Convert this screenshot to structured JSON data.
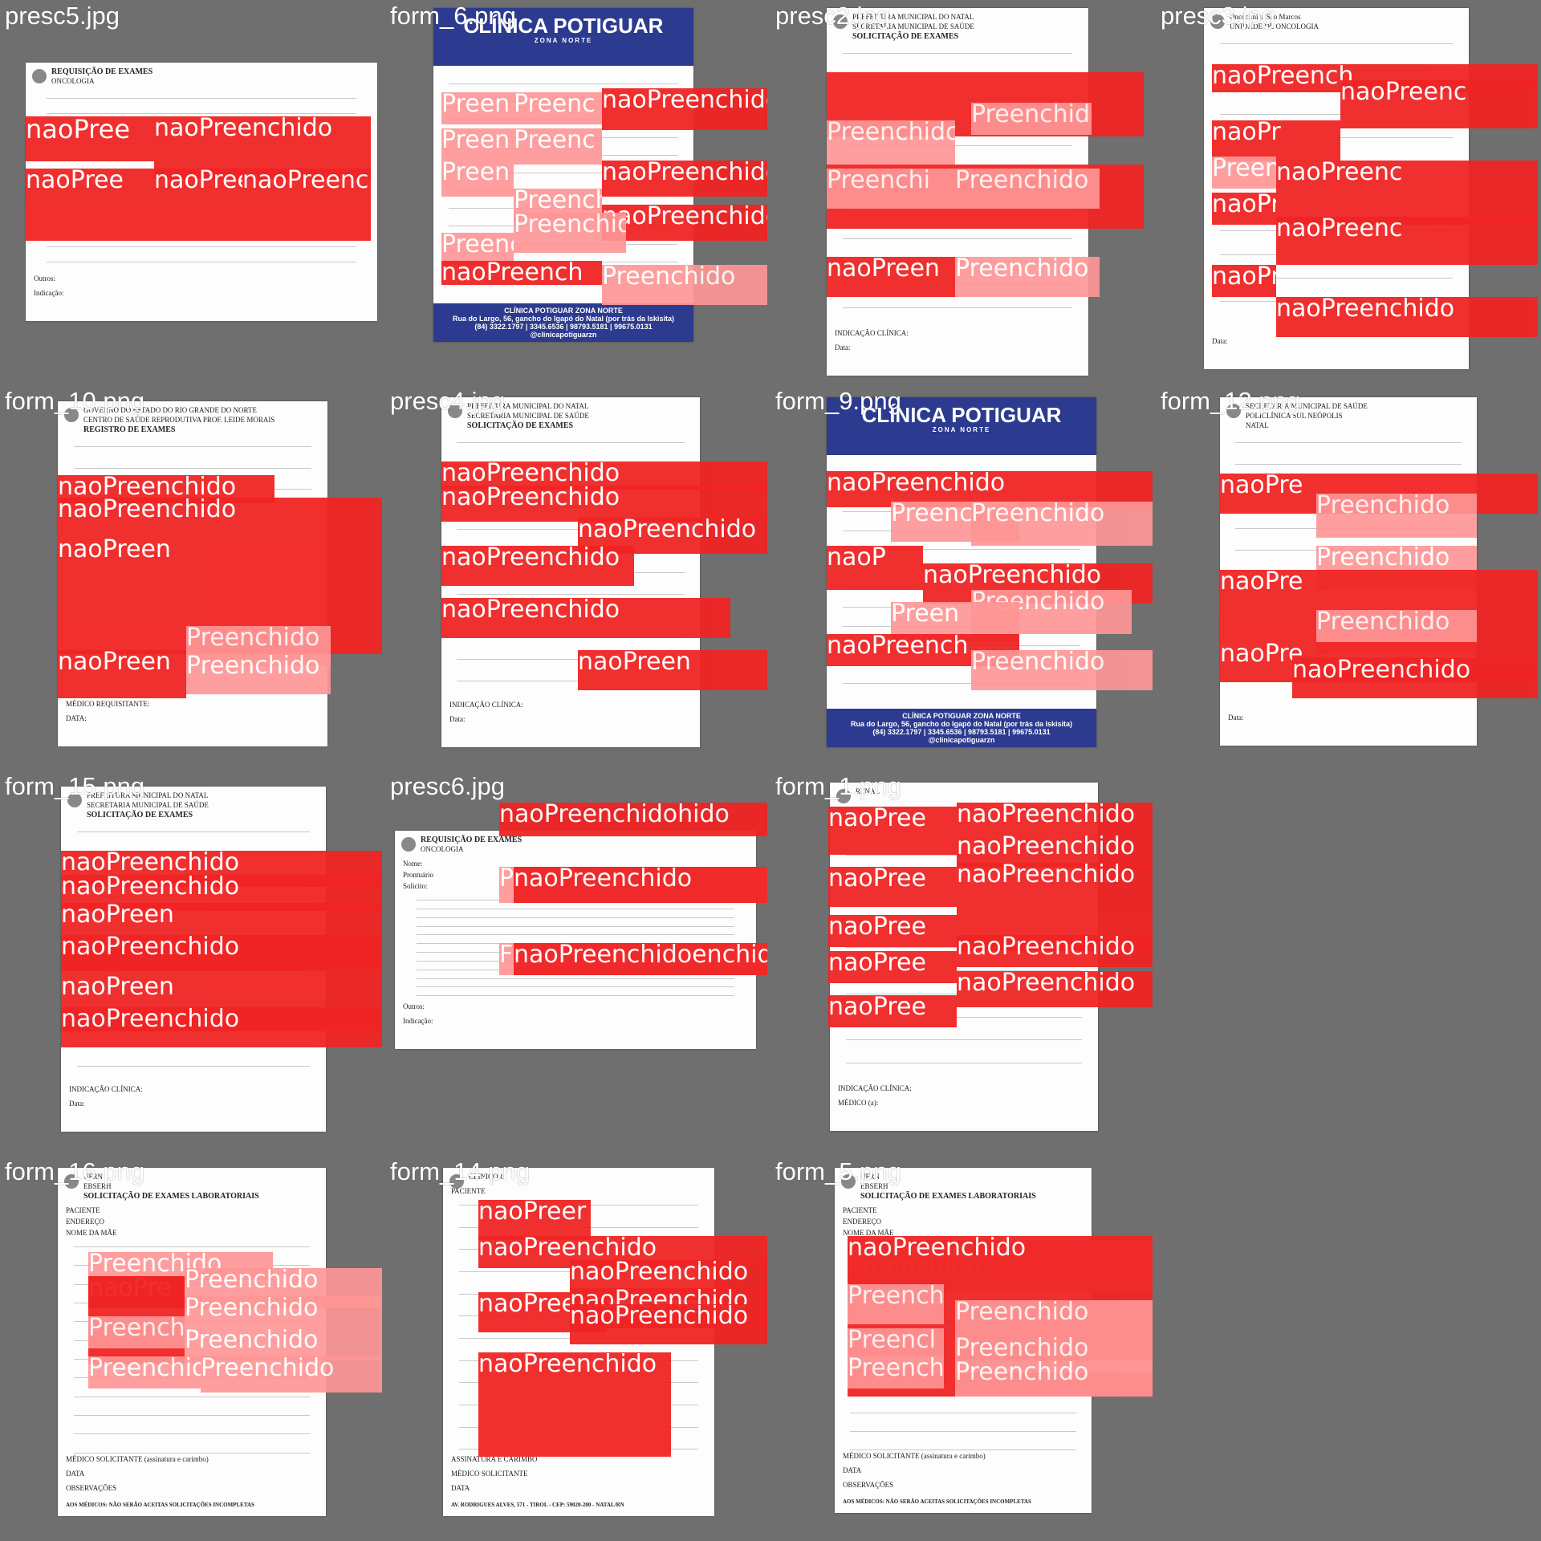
{
  "colors": {
    "background": "#6f6f6f",
    "nao_preenchido": "#f02424",
    "preenchido": "#ff9696",
    "clinic_blue": "#2c3b8f"
  },
  "tiles": [
    {
      "label": "presc5.jpg",
      "doc": {
        "title": "REQUISIÇÃO DE EXAMES",
        "subtitle": "ONCOLOGIA",
        "footer_lines": [
          "Outros:",
          "Indicação:"
        ]
      },
      "boxes": [
        {
          "cls": "naoPreenchido",
          "text": "naoPree"
        },
        {
          "cls": "naoPreenchido",
          "text": "naoPreenchido"
        },
        {
          "cls": "naoPreenchido",
          "text": "naoPree"
        },
        {
          "cls": "naoPreenchido",
          "text": "naoPree"
        },
        {
          "cls": "naoPreenchido",
          "text": "naoPreenchido"
        }
      ]
    },
    {
      "label": "form_6.png",
      "doc": {
        "banner_title": "CLÍNICA POTIGUAR",
        "banner_sub": "ZONA NORTE",
        "footer_title": "CLÍNICA POTIGUAR ZONA NORTE",
        "footer_line1": "Rua do Largo, 56, gancho do Igapó do Natal (por trás da Iskisita)",
        "footer_line2": "(84) 3322.1797 | 3345.6536 | 98793.5181 | 99675.0131",
        "footer_line3": "@clinicapotiguarzn"
      },
      "boxes": [
        {
          "cls": "Preenchido",
          "text": "Preen"
        },
        {
          "cls": "Preenchido",
          "text": "Preenc"
        },
        {
          "cls": "naoPreenchido",
          "text": "naoPreenchido"
        },
        {
          "cls": "Preenchido",
          "text": "Preen"
        },
        {
          "cls": "Preenchido",
          "text": "Preenc"
        },
        {
          "cls": "naoPreenchido",
          "text": "naoPreenchido"
        },
        {
          "cls": "Preenchido",
          "text": "Preen"
        },
        {
          "cls": "Preenchido",
          "text": "Preenchido"
        },
        {
          "cls": "naoPreenchido",
          "text": "naoPreenchido"
        },
        {
          "cls": "Preenchido",
          "text": "Preenc"
        },
        {
          "cls": "Preenchido",
          "text": "Preenchido"
        },
        {
          "cls": "naoPreenchido",
          "text": "naoPreench"
        },
        {
          "cls": "Preenchido",
          "text": "Preenchido"
        }
      ]
    },
    {
      "label": "presc2.jpg",
      "doc": {
        "header1": "PREFEITURA MUNICIPAL DO NATAL",
        "header2": "SECRETARIA MUNICIPAL DE SAÚDE",
        "title": "SOLICITAÇÃO DE EXAMES",
        "footer_lines": [
          "INDICAÇÃO CLÍNICA:",
          "Data:"
        ]
      },
      "boxes": [
        {
          "cls": "naoPreenchido",
          "text": ""
        },
        {
          "cls": "Preenchido",
          "text": "Preenchido"
        },
        {
          "cls": "Preenchido",
          "text": "Preenchido"
        },
        {
          "cls": "naoPreenchido",
          "text": ""
        },
        {
          "cls": "Preenchido",
          "text": "Preenchi"
        },
        {
          "cls": "Preenchido",
          "text": "Preenchido"
        },
        {
          "cls": "naoPreenchido",
          "text": "naoPreen"
        },
        {
          "cls": "Preenchido",
          "text": "Preenchido"
        }
      ]
    },
    {
      "label": "presc3.jpg",
      "doc": {
        "header1": "Oncoclínica São Marcos",
        "header2": "UNIDADE DE ONCOLOGIA",
        "footer_lines": [
          "Data:"
        ]
      },
      "boxes": [
        {
          "cls": "naoPreenchido",
          "text": "naoPreench"
        },
        {
          "cls": "naoPreenchido",
          "text": "naoPreenc"
        },
        {
          "cls": "naoPreenchido",
          "text": "naoPr"
        },
        {
          "cls": "Preenchido",
          "text": "Preen"
        },
        {
          "cls": "naoPreenchido",
          "text": "naoPreenc"
        },
        {
          "cls": "naoPreenchido",
          "text": "naoPr"
        },
        {
          "cls": "naoPreenchido",
          "text": "naoPreenc"
        },
        {
          "cls": "naoPreenchido",
          "text": "naoPr"
        },
        {
          "cls": "naoPreenchido",
          "text": "naoPreenchido"
        }
      ]
    },
    {
      "label": "form_10.png",
      "doc": {
        "header1": "GOVERNO DO ESTADO DO RIO GRANDE DO NORTE",
        "header2": "CENTRO DE SAÚDE REPRODUTIVA PROF. LEIDE MORAIS",
        "title": "REGISTRO DE EXAMES",
        "footer_lines": [
          "MÉDICO REQUISITANTE:",
          "DATA:"
        ]
      },
      "boxes": [
        {
          "cls": "naoPreenchido",
          "text": "naoPreenchido"
        },
        {
          "cls": "naoPreenchido",
          "text": "naoPreenchido"
        },
        {
          "cls": "naoPreenchido",
          "text": "naoPreen"
        },
        {
          "cls": "Preenchido",
          "text": "Preenchido"
        },
        {
          "cls": "naoPreenchido",
          "text": "naoPreen"
        },
        {
          "cls": "Preenchido",
          "text": "Preenchido"
        }
      ]
    },
    {
      "label": "presc4.jpg",
      "doc": {
        "header1": "PREFEITURA MUNICIPAL DO NATAL",
        "header2": "SECRETARIA MUNICIPAL DE SAÚDE",
        "title": "SOLICITAÇÃO DE EXAMES",
        "footer_lines": [
          "INDICAÇÃO CLÍNICA:",
          "Data:"
        ]
      },
      "boxes": [
        {
          "cls": "naoPreenchido",
          "text": "naoPreenchido"
        },
        {
          "cls": "naoPreenchido",
          "text": "naoPreenchido"
        },
        {
          "cls": "naoPreenchido",
          "text": "naoPreenchido"
        },
        {
          "cls": "naoPreenchido",
          "text": "naoPreenchido"
        },
        {
          "cls": "naoPreenchido",
          "text": "naoPreenchido"
        },
        {
          "cls": "naoPreenchido",
          "text": "naoPreen"
        }
      ]
    },
    {
      "label": "form_9.png",
      "doc": {
        "banner_title": "CLÍNICA POTIGUAR",
        "banner_sub": "ZONA NORTE",
        "footer_title": "CLÍNICA POTIGUAR ZONA NORTE",
        "footer_line1": "Rua do Largo, 56, gancho do Igapó do Natal (por trás da Iskisita)",
        "footer_line2": "(84) 3322.1797 | 3345.6536 | 98793.5181 | 99675.0131",
        "footer_line3": "@clinicapotiguarzn"
      },
      "boxes": [
        {
          "cls": "naoPreenchido",
          "text": "naoPreenchido"
        },
        {
          "cls": "Preenchido",
          "text": "Preenc"
        },
        {
          "cls": "Preenchido",
          "text": "Preenchido"
        },
        {
          "cls": "naoPreenchido",
          "text": "naoP"
        },
        {
          "cls": "naoPreenchido",
          "text": "naoPreenchido"
        },
        {
          "cls": "Preenchido",
          "text": "Preenchido"
        },
        {
          "cls": "Preenchido",
          "text": "Preen"
        },
        {
          "cls": "naoPreenchido",
          "text": "naoPreench"
        },
        {
          "cls": "Preenchido",
          "text": "Preenchido"
        }
      ]
    },
    {
      "label": "form_12.png",
      "doc": {
        "header1": "SECRETARIA MUNICIPAL DE SAÚDE",
        "header2": "POLICLÍNICA SUL NEÓPOLIS",
        "header3": "NATAL",
        "footer_lines": [
          "Data:"
        ]
      },
      "boxes": [
        {
          "cls": "naoPreenchido",
          "text": "naoPre"
        },
        {
          "cls": "Preenchido",
          "text": "Preenchido"
        },
        {
          "cls": "Preenchido",
          "text": "Preenchido"
        },
        {
          "cls": "naoPreenchido",
          "text": "naoPre"
        },
        {
          "cls": "Preenchido",
          "text": "Preenchido"
        },
        {
          "cls": "naoPreenchido",
          "text": "naoPre"
        },
        {
          "cls": "naoPreenchido",
          "text": "naoPreenchido"
        }
      ]
    },
    {
      "label": "form_15.png",
      "doc": {
        "header1": "PREFEITURA MUNICIPAL DO NATAL",
        "header2": "SECRETARIA MUNICIPAL DE SAÚDE",
        "title": "SOLICITAÇÃO DE EXAMES",
        "footer_lines": [
          "INDICAÇÃO CLÍNICA:",
          "Data:"
        ]
      },
      "boxes": [
        {
          "cls": "naoPreenchido",
          "text": "naoPreenchido"
        },
        {
          "cls": "naoPreenchido",
          "text": "naoPreenchido"
        },
        {
          "cls": "naoPreenchido",
          "text": "naoPreen"
        },
        {
          "cls": "naoPreenchido",
          "text": "naoPreenchido"
        },
        {
          "cls": "naoPreenchido",
          "text": "naoPreen"
        },
        {
          "cls": "naoPreenchido",
          "text": "naoPreenchido"
        }
      ]
    },
    {
      "label": "presc6.jpg",
      "doc": {
        "title": "REQUISIÇÃO DE EXAMES",
        "subtitle": "ONCOLOGIA",
        "field1": "Nome:",
        "field2": "Prontuário",
        "field3": "Solicito:",
        "footer_lines": [
          "Outros:",
          "Indicação:"
        ]
      },
      "boxes": [
        {
          "cls": "naoPreenchido",
          "text": "naoPreenchidohido"
        },
        {
          "cls": "Preenchido",
          "text": "P"
        },
        {
          "cls": "naoPreenchido",
          "text": "naoPreenchido"
        },
        {
          "cls": "Preenchido",
          "text": "F"
        },
        {
          "cls": "naoPreenchido",
          "text": "naoPreenchidoenchido"
        }
      ]
    },
    {
      "label": "form_1.png",
      "doc": {
        "header1": "RENAL",
        "footer_lines": [
          "INDICAÇÃO CLÍNICA:",
          "MÉDICO (a):"
        ]
      },
      "boxes": [
        {
          "cls": "naoPreenchido",
          "text": "naoPree"
        },
        {
          "cls": "naoPreenchido",
          "text": "naoPreenchido"
        },
        {
          "cls": "naoPreenchido",
          "text": "naoPreenchido"
        },
        {
          "cls": "naoPreenchido",
          "text": "naoPree"
        },
        {
          "cls": "naoPreenchido",
          "text": "naoPreenchido"
        },
        {
          "cls": "naoPreenchido",
          "text": "naoPree"
        },
        {
          "cls": "naoPreenchido",
          "text": "naoPreenchido"
        },
        {
          "cls": "naoPreenchido",
          "text": "naoPree"
        },
        {
          "cls": "naoPreenchido",
          "text": "naoPreenchido"
        },
        {
          "cls": "naoPreenchido",
          "text": "naoPree"
        }
      ]
    },
    {
      "label": "",
      "doc": null,
      "boxes": []
    },
    {
      "label": "form_16.png",
      "doc": {
        "header1": "UFRN",
        "header2": "EBSERH",
        "title": "SOLICITAÇÃO DE EXAMES LABORATORIAIS",
        "field1": "PACIENTE",
        "field2": "ENDEREÇO",
        "field3": "NOME DA MÃE",
        "footer_lines": [
          "MÉDICO SOLICITANTE (assinatura e carimbo)",
          "DATA",
          "OBSERVAÇÕES"
        ],
        "footer_note": "AOS MÉDICOS: NÃO SERÃO ACEITAS SOLICITAÇÕES INCOMPLETAS"
      },
      "boxes": [
        {
          "cls": "Preenchido",
          "text": "Preenchido"
        },
        {
          "cls": "naoPreenchido",
          "text": "naoPre"
        },
        {
          "cls": "Preenchido",
          "text": "Preenchido"
        },
        {
          "cls": "Preenchido",
          "text": "Preenchido"
        },
        {
          "cls": "naoPreenchido",
          "text": ""
        },
        {
          "cls": "Preenchido",
          "text": "Preench"
        },
        {
          "cls": "Preenchido",
          "text": "Preenchido"
        },
        {
          "cls": "Preenchido",
          "text": "Preenchido"
        },
        {
          "cls": "Preenchido",
          "text": "Preenchido"
        }
      ]
    },
    {
      "label": "form_14.png",
      "doc": {
        "header1": "CLINICOR",
        "field1": "PACIENTE",
        "footer_lines": [
          "ASSINATURA E CARIMBO",
          "MÉDICO SOLICITANTE",
          "DATA"
        ],
        "footer_note": "AV. RODRIGUES ALVES, 571 - TIROL - CEP: 59020-200 - NATAL/RN"
      },
      "boxes": [
        {
          "cls": "naoPreenchido",
          "text": "naoPreer"
        },
        {
          "cls": "naoPreenchido",
          "text": "naoPreenchido"
        },
        {
          "cls": "naoPreenchido",
          "text": "naoPreenchido"
        },
        {
          "cls": "naoPreenchido",
          "text": "naoPreer"
        },
        {
          "cls": "naoPreenchido",
          "text": "naoPreenchido"
        },
        {
          "cls": "naoPreenchido",
          "text": "naoPreenchido"
        },
        {
          "cls": "naoPreenchido",
          "text": "naoPreenchido"
        }
      ]
    },
    {
      "label": "form_5.png",
      "doc": {
        "header1": "UFRN",
        "header2": "EBSERH",
        "title": "SOLICITAÇÃO DE EXAMES LABORATORIAIS",
        "field1": "PACIENTE",
        "field2": "ENDEREÇO",
        "field3": "NOME DA MÃE",
        "footer_lines": [
          "MÉDICO SOLICITANTE (assinatura e carimbo)",
          "DATA",
          "OBSERVAÇÕES"
        ],
        "footer_note": "AOS MÉDICOS: NÃO SERÃO ACEITAS SOLICITAÇÕES INCOMPLETAS"
      },
      "boxes": [
        {
          "cls": "Preenchido",
          "text": "Preenchido"
        },
        {
          "cls": "Preenchido",
          "text": "Preenchido"
        },
        {
          "cls": "naoPreenchido",
          "text": "naoPreenchido"
        },
        {
          "cls": "Preenchido",
          "text": "Preench"
        },
        {
          "cls": "Preenchido",
          "text": "Preenchido"
        },
        {
          "cls": "Preenchido",
          "text": "Preencl"
        },
        {
          "cls": "Preenchido",
          "text": "Preenchido"
        },
        {
          "cls": "Preenchido",
          "text": "Preenchido"
        },
        {
          "cls": "Preenchido",
          "text": "Preenchido"
        }
      ]
    },
    {
      "label": "",
      "doc": null,
      "boxes": []
    }
  ]
}
